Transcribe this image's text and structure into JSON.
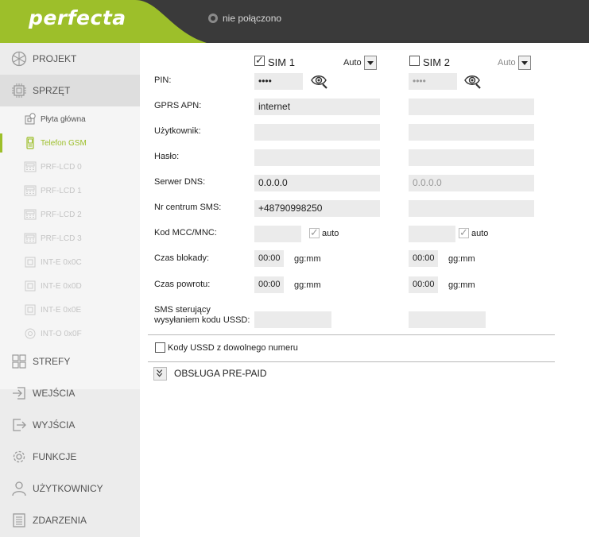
{
  "header": {
    "logo": "perfecta",
    "connection_status": "nie połączono"
  },
  "sidebar": {
    "categories": [
      {
        "label": "PROJEKT",
        "icon": "cube-icon"
      },
      {
        "label": "SPRZĘT",
        "icon": "chip-icon"
      },
      {
        "label": "STREFY",
        "icon": "grid-icon"
      },
      {
        "label": "WEJŚCIA",
        "icon": "input-icon"
      },
      {
        "label": "WYJŚCIA",
        "icon": "output-icon"
      },
      {
        "label": "FUNKCJE",
        "icon": "gear-icon"
      },
      {
        "label": "UŻYTKOWNICY",
        "icon": "user-icon"
      },
      {
        "label": "ZDARZENIA",
        "icon": "list-icon"
      }
    ],
    "sub_items": [
      {
        "label": "Płyta główna",
        "state": "normal"
      },
      {
        "label": "Telefon GSM",
        "state": "active"
      },
      {
        "label": "PRF-LCD 0",
        "state": "disabled"
      },
      {
        "label": "PRF-LCD 1",
        "state": "disabled"
      },
      {
        "label": "PRF-LCD 2",
        "state": "disabled"
      },
      {
        "label": "PRF-LCD 3",
        "state": "disabled"
      },
      {
        "label": "INT-E 0x0C",
        "state": "disabled"
      },
      {
        "label": "INT-E 0x0D",
        "state": "disabled"
      },
      {
        "label": "INT-E 0x0E",
        "state": "disabled"
      },
      {
        "label": "INT-O 0x0F",
        "state": "disabled"
      }
    ]
  },
  "gsm": {
    "sim1": {
      "label": "SIM 1",
      "checked": true,
      "mode": "Auto"
    },
    "sim2": {
      "label": "SIM 2",
      "checked": false,
      "mode": "Auto"
    },
    "labels": {
      "pin": "PIN:",
      "apn": "GPRS APN:",
      "user": "Użytkownik:",
      "password": "Hasło:",
      "dns": "Serwer DNS:",
      "sms_center": "Nr centrum SMS:",
      "mcc": "Kod MCC/MNC:",
      "block_time": "Czas blokady:",
      "return_time": "Czas powrotu:",
      "ussd_line1": "SMS sterujący",
      "ussd_line2": "wysyłaniem kodu USSD:"
    },
    "sim1_values": {
      "pin": "••••",
      "apn": "internet",
      "user": "",
      "password": "",
      "dns": "0.0.0.0",
      "sms_center": "+48790998250",
      "mcc": "",
      "mcc_auto": "auto",
      "block_time": "00:00",
      "return_time": "00:00",
      "ussd": ""
    },
    "sim2_values": {
      "pin": "••••",
      "apn": "",
      "user": "",
      "password": "",
      "dns": "0.0.0.0",
      "sms_center": "",
      "mcc": "",
      "mcc_auto": "auto",
      "block_time": "00:00",
      "return_time": "00:00",
      "ussd": ""
    },
    "time_unit": "gg:mm",
    "ussd_any_number": "Kody USSD z dowolnego numeru",
    "prepaid_section": "OBSŁUGA PRE-PAID"
  },
  "colors": {
    "accent": "#9dbf2a",
    "header_bg": "#3a3a3a",
    "sidebar_bg": "#ececec",
    "field_bg": "#ebebeb"
  }
}
